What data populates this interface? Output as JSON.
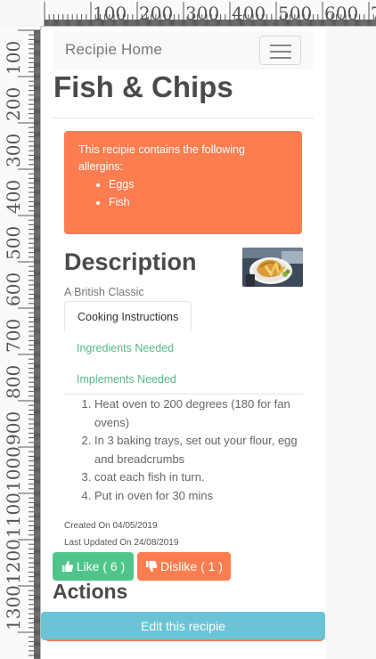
{
  "navbar": {
    "brand": "Recipie Home",
    "toggler_icon": "hamburger-menu-icon"
  },
  "recipe": {
    "title": "Fish & Chips",
    "allergen_notice": "This recipie contains the following allergins:",
    "allergens": [
      "Eggs",
      "Fish"
    ],
    "description_heading": "Description",
    "subtitle": "A British Classic",
    "photo": "fish-and-chips-photo"
  },
  "tabs": [
    "Cooking Instructions",
    "Ingredients Needed",
    "Implements Needed"
  ],
  "steps": [
    "Heat oven to 200 degrees (180 for fan ovens)",
    "In 3 baking trays, set out your flour, egg and breadcrumbs",
    "coat each fish in turn.",
    "Put in oven for 30 mins"
  ],
  "meta": {
    "created": "Created On 04/05/2019",
    "updated": "Last Updated On 24/08/2019"
  },
  "buttons": {
    "like": "Like ( 6 )",
    "dislike": "Dislike ( 1 )",
    "like_icon": "thumbs-up-icon",
    "dislike_icon": "thumbs-down-icon"
  },
  "actions": {
    "heading": "Actions",
    "edit_label": "Edit this recipie"
  },
  "colors": {
    "alert": "#fb7d50",
    "like": "#4fc58b",
    "dislike": "#fb7d50",
    "edit": "#6cc3d5",
    "tab_link": "#55b888"
  }
}
